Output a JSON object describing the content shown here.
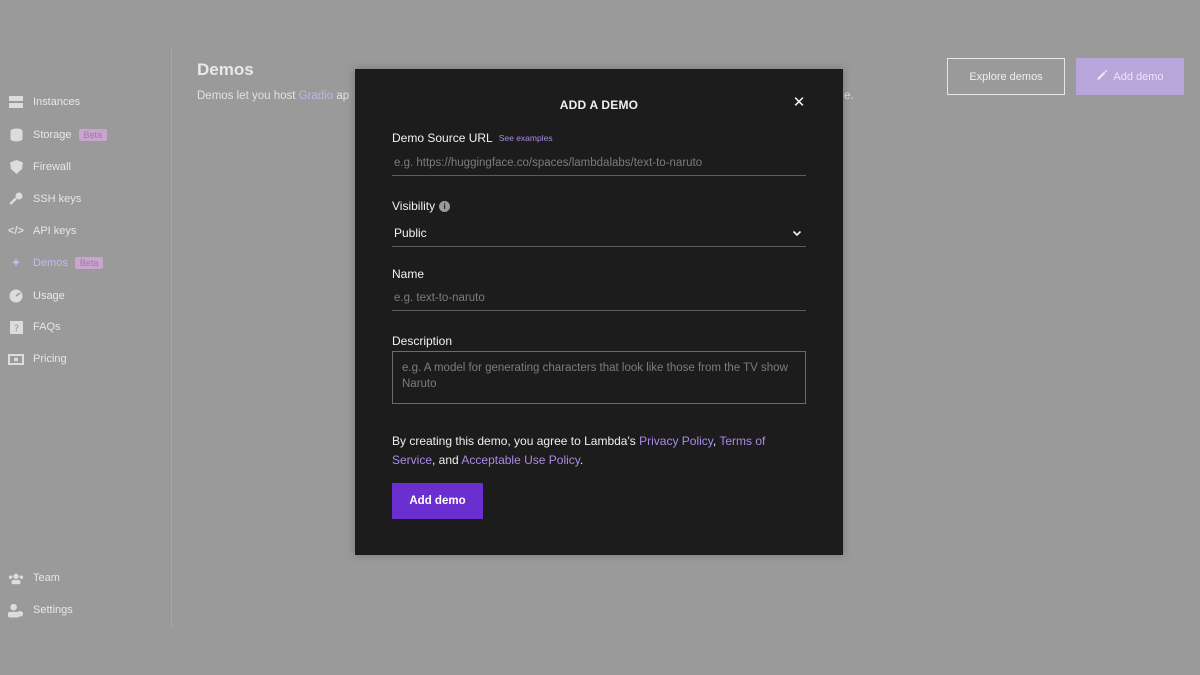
{
  "sidebar": {
    "items": [
      {
        "label": "Instances",
        "icon": "server-icon"
      },
      {
        "label": "Storage",
        "icon": "database-icon",
        "badge": "Beta"
      },
      {
        "label": "Firewall",
        "icon": "shield-icon"
      },
      {
        "label": "SSH keys",
        "icon": "key-icon"
      },
      {
        "label": "API keys",
        "icon": "code-icon"
      },
      {
        "label": "Demos",
        "icon": "sparkle-icon",
        "badge": "Beta",
        "active": true
      },
      {
        "label": "Usage",
        "icon": "gauge-icon"
      },
      {
        "label": "FAQs",
        "icon": "question-icon"
      },
      {
        "label": "Pricing",
        "icon": "pricing-icon"
      }
    ],
    "bottom_items": [
      {
        "label": "Team",
        "icon": "team-icon"
      },
      {
        "label": "Settings",
        "icon": "user-settings-icon"
      }
    ]
  },
  "main": {
    "title": "Demos",
    "description_prefix": "Demos let you host ",
    "description_link": "Gradio",
    "description_suffix": " ap",
    "description_tail": "e.",
    "explore_button": "Explore demos",
    "add_button": "Add demo"
  },
  "modal": {
    "title": "ADD A DEMO",
    "source_label": "Demo Source URL",
    "see_examples": "See examples",
    "source_placeholder": "e.g. https://huggingface.co/spaces/lambdalabs/text-to-naruto",
    "visibility_label": "Visibility",
    "visibility_value": "Public",
    "name_label": "Name",
    "name_placeholder": "e.g. text-to-naruto",
    "description_label": "Description",
    "description_placeholder": "e.g. A model for generating characters that look like those from the TV show Naruto",
    "terms_prefix": "By creating this demo, you agree to Lambda's ",
    "privacy_policy": "Privacy Policy",
    "comma": ", ",
    "terms_of_service": "Terms of Service",
    "and": ", and ",
    "acceptable_use": "Acceptable Use Policy",
    "period": ".",
    "submit_label": "Add demo"
  },
  "colors": {
    "overlay": "#9a9a9a",
    "modal_bg": "#1c1c1c",
    "accent": "#6b2fd0",
    "link": "#a88ae6"
  }
}
